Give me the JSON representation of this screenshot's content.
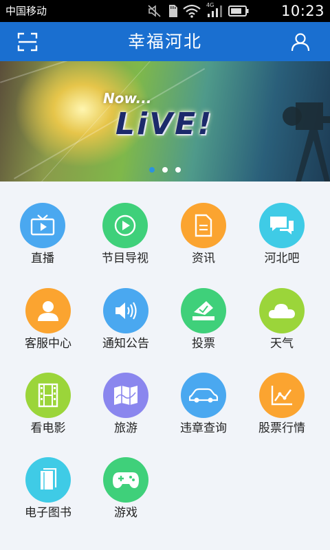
{
  "status_bar": {
    "carrier": "中国移动",
    "network": "4G",
    "time": "10:23"
  },
  "header": {
    "title": "幸福河北",
    "scan_icon": "scan-icon",
    "profile_icon": "user-icon"
  },
  "banner": {
    "line1": "Now...",
    "line2": "LiVE!",
    "dots": 3,
    "active_dot": 0
  },
  "menu": {
    "items": [
      {
        "label": "直播",
        "icon": "tv-icon",
        "color": "#4aa8f0"
      },
      {
        "label": "节目导视",
        "icon": "play-icon",
        "color": "#3fd07a"
      },
      {
        "label": "资讯",
        "icon": "document-icon",
        "color": "#fba430"
      },
      {
        "label": "河北吧",
        "icon": "chat-icon",
        "color": "#3fcbe6"
      },
      {
        "label": "客服中心",
        "icon": "person-icon",
        "color": "#fba430"
      },
      {
        "label": "通知公告",
        "icon": "speaker-icon",
        "color": "#4aa8f0"
      },
      {
        "label": "投票",
        "icon": "vote-icon",
        "color": "#3fd07a"
      },
      {
        "label": "天气",
        "icon": "cloud-icon",
        "color": "#9bd53a"
      },
      {
        "label": "看电影",
        "icon": "film-icon",
        "color": "#9bd53a"
      },
      {
        "label": "旅游",
        "icon": "map-icon",
        "color": "#8a86ee"
      },
      {
        "label": "违章查询",
        "icon": "car-icon",
        "color": "#4aa8f0"
      },
      {
        "label": "股票行情",
        "icon": "stock-chart-icon",
        "color": "#fba430"
      },
      {
        "label": "电子图书",
        "icon": "book-icon",
        "color": "#3fcbe6"
      },
      {
        "label": "游戏",
        "icon": "gamepad-icon",
        "color": "#3fd07a"
      }
    ]
  }
}
